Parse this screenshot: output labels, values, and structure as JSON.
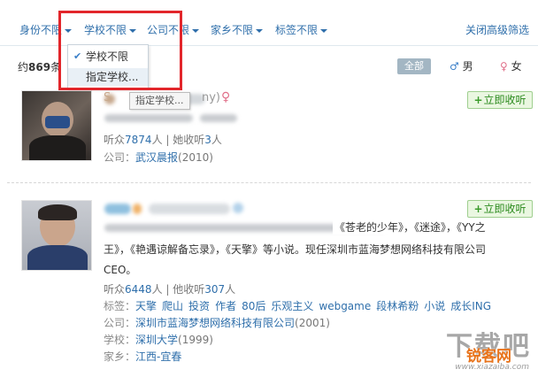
{
  "filters": [
    {
      "label": "身份不限"
    },
    {
      "label": "学校不限"
    },
    {
      "label": "公司不限"
    },
    {
      "label": "家乡不限"
    },
    {
      "label": "标签不限"
    }
  ],
  "close_advanced": "关闭高级筛选",
  "result_count": {
    "prefix": "约",
    "number": "869",
    "suffix": "条"
  },
  "gender_tabs": {
    "all": "全部",
    "male_symbol": "♂",
    "male": "男",
    "female_symbol": "♀",
    "female": "女"
  },
  "dropdown": {
    "check": "✔",
    "items": [
      {
        "label": "学校不限"
      },
      {
        "label": "指定学校..."
      }
    ]
  },
  "tooltip": "指定学校...",
  "listen_label": "立即收听",
  "listen_plus": "+",
  "users": [
    {
      "name_fragment": "S",
      "name_tail": "ny)",
      "gender_symbol": "♀",
      "followers_label": "听众",
      "followers": "7874",
      "followers_unit": "人",
      "sep": " | ",
      "following_label": "她收听",
      "following": "3",
      "following_unit": "人",
      "company_label": "公司：",
      "company": "武汉晨报",
      "company_year": "(2010)"
    },
    {
      "bio_line1": "《苍老的少年》，《迷途》，《YY之",
      "bio_line2": "王》，《艳遇谅解备忘录》，《天擎》等小说。现任深圳市蓝海梦想网络科技有限公司",
      "bio_line3": "CEO。",
      "followers_label": "听众",
      "followers": "6448",
      "followers_unit": "人",
      "sep": " | ",
      "following_label": "他收听",
      "following": "307",
      "following_unit": "人",
      "tags_label": "标签：",
      "tags": [
        "天擎",
        "爬山",
        "投资",
        "作者",
        "80后",
        "乐观主义",
        "webgame",
        "段林希粉",
        "小说",
        "成长ING"
      ],
      "company_label": "公司：",
      "company": "深圳市蓝海梦想网络科技有限公司",
      "company_year": "(2001)",
      "school_label": "学校：",
      "school": "深圳大学",
      "school_year": "(1999)",
      "hometown_label": "家乡：",
      "hometown": "江西-宜春"
    }
  ],
  "watermark": {
    "big": "下载吧",
    "brand": "锐客网",
    "url": "www.xiazaiba.com"
  },
  "colors": {
    "link": "#2f6fab",
    "highlight": "#e2262b",
    "listen_green": "#2b8a1d",
    "female": "#e0708a",
    "male": "#3a7fc8"
  }
}
